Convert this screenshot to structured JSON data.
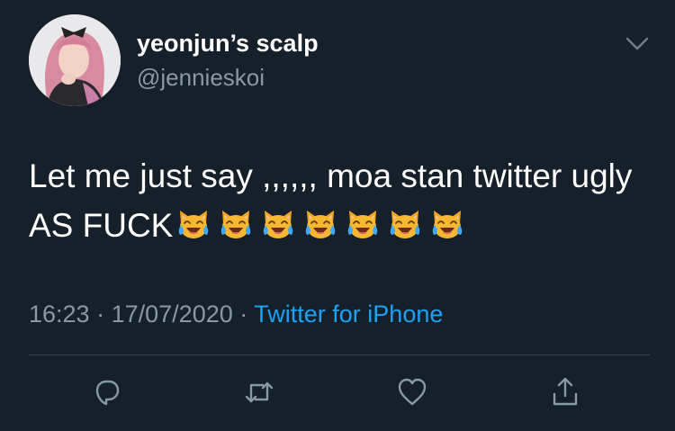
{
  "user": {
    "display_name": "yeonjun’s scalp",
    "handle": "@jennieskoi"
  },
  "tweet": {
    "text": "Let me just say ,,,,,, moa stan twitter ugly AS FUCK",
    "emoji": [
      "cat-with-tears-of-joy",
      "cat-with-tears-of-joy",
      "cat-with-tears-of-joy",
      "cat-with-tears-of-joy",
      "cat-with-tears-of-joy",
      "cat-with-tears-of-joy",
      "cat-with-tears-of-joy"
    ],
    "time": "16:23",
    "separator": "·",
    "date": "17/07/2020",
    "source": "Twitter for iPhone"
  },
  "actions": [
    {
      "name": "reply",
      "icon": "reply-icon"
    },
    {
      "name": "retweet",
      "icon": "retweet-icon"
    },
    {
      "name": "like",
      "icon": "heart-icon"
    },
    {
      "name": "share",
      "icon": "share-icon"
    }
  ],
  "colors": {
    "background": "#15202b",
    "text": "#ffffff",
    "secondary": "#8899a6",
    "link": "#1da1f2",
    "divider": "#38444d"
  }
}
